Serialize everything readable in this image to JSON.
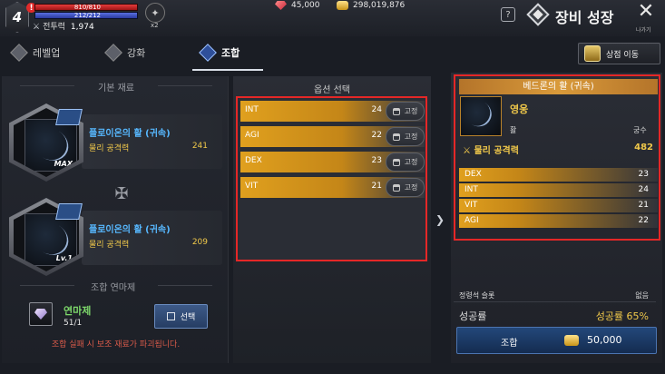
{
  "player": {
    "level": "4",
    "warning_mark": "!",
    "hp_text": "810/810",
    "hp_fraction": 1.0,
    "mp_text": "212/212",
    "mp_fraction": 1.0,
    "power_label": "전투력",
    "power_value": "1,974",
    "buff_count": "x2"
  },
  "currency": {
    "gem_amount": "45,000",
    "gold_amount": "298,019,876"
  },
  "header": {
    "help_label": "?",
    "title": "장비 성장",
    "close_symbol": "✕",
    "close_label": "나가기"
  },
  "tabs": [
    {
      "label": "레벨업",
      "active": false
    },
    {
      "label": "강화",
      "active": false
    },
    {
      "label": "조합",
      "active": true
    }
  ],
  "shop_button": {
    "label": "상점 이동"
  },
  "base_materials": {
    "title": "기본 재료",
    "items": [
      {
        "name": "플로이온의 활 (귀속)",
        "stat_label": "물리 공격력",
        "stat_value": "241",
        "tag": "MAX"
      },
      {
        "name": "플로이온의 활 (귀속)",
        "stat_label": "물리 공격력",
        "stat_value": "209",
        "tag": "Lv.1"
      }
    ]
  },
  "catalyst": {
    "title": "조합 연마제",
    "name": "연마제",
    "count": "51/1",
    "select_label": "선택",
    "warning": "조합 실패 시 보조 재료가 파괴됩니다."
  },
  "options": {
    "title": "옵션 선택",
    "lock_label": "고정",
    "rows": [
      {
        "label": "INT",
        "value": "24",
        "fill": 1.0
      },
      {
        "label": "AGI",
        "value": "22",
        "fill": 1.0
      },
      {
        "label": "DEX",
        "value": "23",
        "fill": 1.0
      },
      {
        "label": "VIT",
        "value": "21",
        "fill": 1.0
      }
    ]
  },
  "result": {
    "name": "베드론의 활 (귀속)",
    "grade": "영웅",
    "kind": "활",
    "class": "궁수",
    "main_stat_label": "물리 공격력",
    "main_stat_value": "482",
    "rows": [
      {
        "label": "DEX",
        "value": "23"
      },
      {
        "label": "INT",
        "value": "24"
      },
      {
        "label": "VIT",
        "value": "21"
      },
      {
        "label": "AGI",
        "value": "22"
      }
    ]
  },
  "footer": {
    "stone_label": "정령석 슬롯",
    "stone_value": "없음",
    "rate_label": "성공률",
    "rate_value": "성공률 65%",
    "combine_label": "조합",
    "combine_cost": "50,000"
  },
  "colors": {
    "accent_gold": "#f0c84a",
    "item_name_blue": "#57b8ff",
    "highlight_red": "#e52727",
    "warning_text": "#d95a4a"
  }
}
